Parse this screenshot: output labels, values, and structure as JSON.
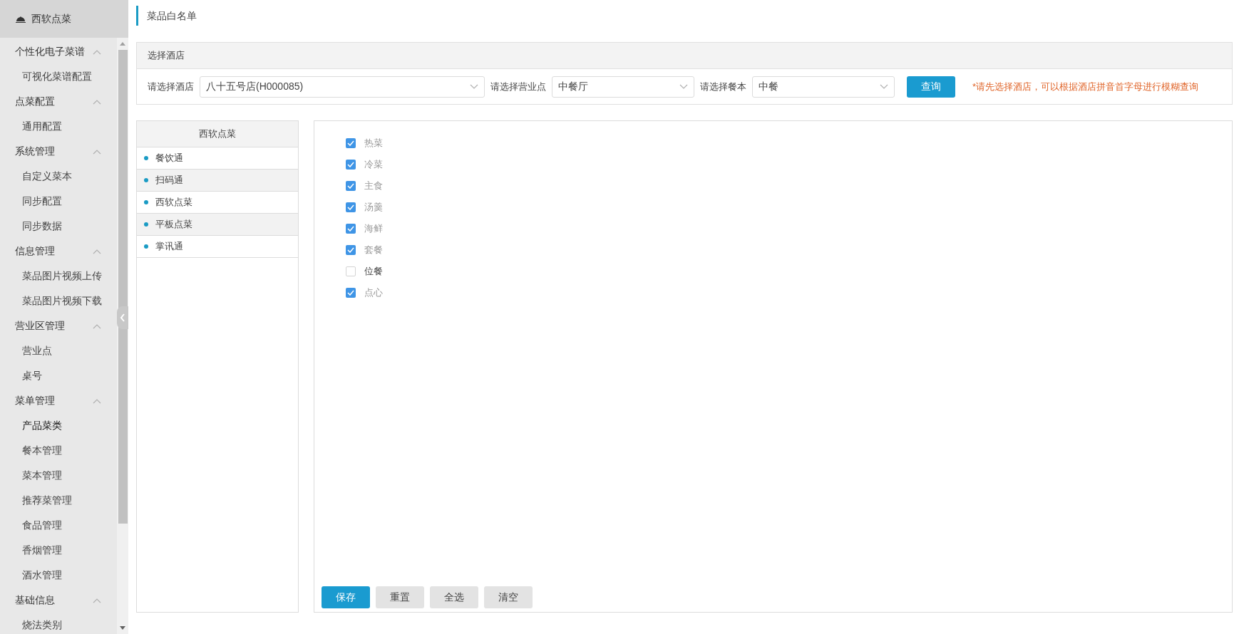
{
  "sidebar": {
    "brand": "西软点菜",
    "groups": [
      {
        "label": "个性化电子菜谱",
        "expanded": true,
        "children": [
          {
            "label": "可视化菜谱配置",
            "selected": false
          }
        ]
      },
      {
        "label": "点菜配置",
        "expanded": true,
        "children": [
          {
            "label": "通用配置",
            "selected": false
          }
        ]
      },
      {
        "label": "系统管理",
        "expanded": true,
        "children": [
          {
            "label": "自定义菜本",
            "selected": false
          },
          {
            "label": "同步配置",
            "selected": false
          },
          {
            "label": "同步数据",
            "selected": false
          }
        ]
      },
      {
        "label": "信息管理",
        "expanded": true,
        "children": [
          {
            "label": "菜品图片视频上传",
            "selected": false
          },
          {
            "label": "菜品图片视频下载",
            "selected": false
          }
        ]
      },
      {
        "label": "营业区管理",
        "expanded": true,
        "children": [
          {
            "label": "营业点",
            "selected": false
          },
          {
            "label": "桌号",
            "selected": false
          }
        ]
      },
      {
        "label": "菜单管理",
        "expanded": true,
        "children": [
          {
            "label": "产品菜类",
            "selected": true
          },
          {
            "label": "餐本管理",
            "selected": false
          },
          {
            "label": "菜本管理",
            "selected": false
          },
          {
            "label": "推荐菜管理",
            "selected": false
          },
          {
            "label": "食品管理",
            "selected": false
          },
          {
            "label": "香烟管理",
            "selected": false
          },
          {
            "label": "酒水管理",
            "selected": false
          }
        ]
      },
      {
        "label": "基础信息",
        "expanded": true,
        "children": [
          {
            "label": "烧法类别",
            "selected": false
          }
        ]
      }
    ]
  },
  "page_title": "菜品白名单",
  "filter": {
    "title": "选择酒店",
    "fields": [
      {
        "label": "请选择酒店",
        "value": "八十五号店(H000085)"
      },
      {
        "label": "请选择营业点",
        "value": "中餐厅"
      },
      {
        "label": "请选择餐本",
        "value": "中餐"
      }
    ],
    "query_button": "查询",
    "hint": "*请先选择酒店，可以根据酒店拼音首字母进行模糊查询"
  },
  "systems": {
    "title": "西软点菜",
    "items": [
      "餐饮通",
      "扫码通",
      "西软点菜",
      "平板点菜",
      "掌讯通"
    ]
  },
  "categories": [
    {
      "label": "热菜",
      "checked": true
    },
    {
      "label": "冷菜",
      "checked": true
    },
    {
      "label": "主食",
      "checked": true
    },
    {
      "label": "汤羹",
      "checked": true
    },
    {
      "label": "海鲜",
      "checked": true
    },
    {
      "label": "套餐",
      "checked": true
    },
    {
      "label": "位餐",
      "checked": false
    },
    {
      "label": "点心",
      "checked": true
    }
  ],
  "actions": [
    {
      "label": "保存",
      "kind": "primary"
    },
    {
      "label": "重置",
      "kind": "secondary"
    },
    {
      "label": "全选",
      "kind": "secondary"
    },
    {
      "label": "清空",
      "kind": "secondary"
    }
  ]
}
